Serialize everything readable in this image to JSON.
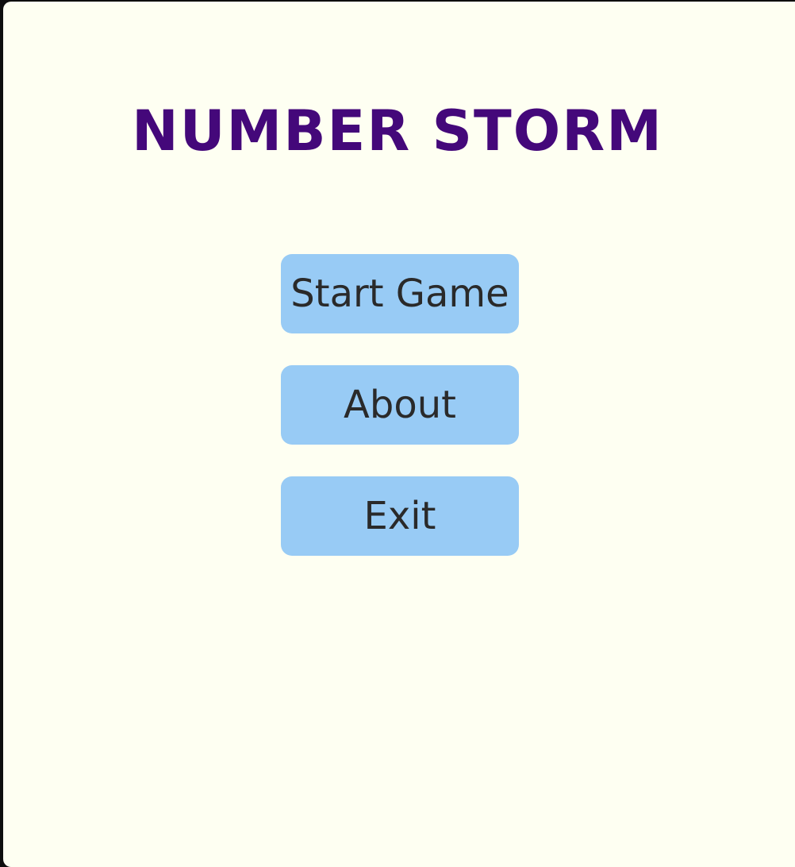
{
  "title": "NUMBER STORM",
  "menu": {
    "start_label": "Start Game",
    "about_label": "About",
    "exit_label": "Exit"
  },
  "colors": {
    "background": "#fefff2",
    "title": "#44087a",
    "button": "#98cbf5",
    "button_text": "#2a2a2a"
  }
}
